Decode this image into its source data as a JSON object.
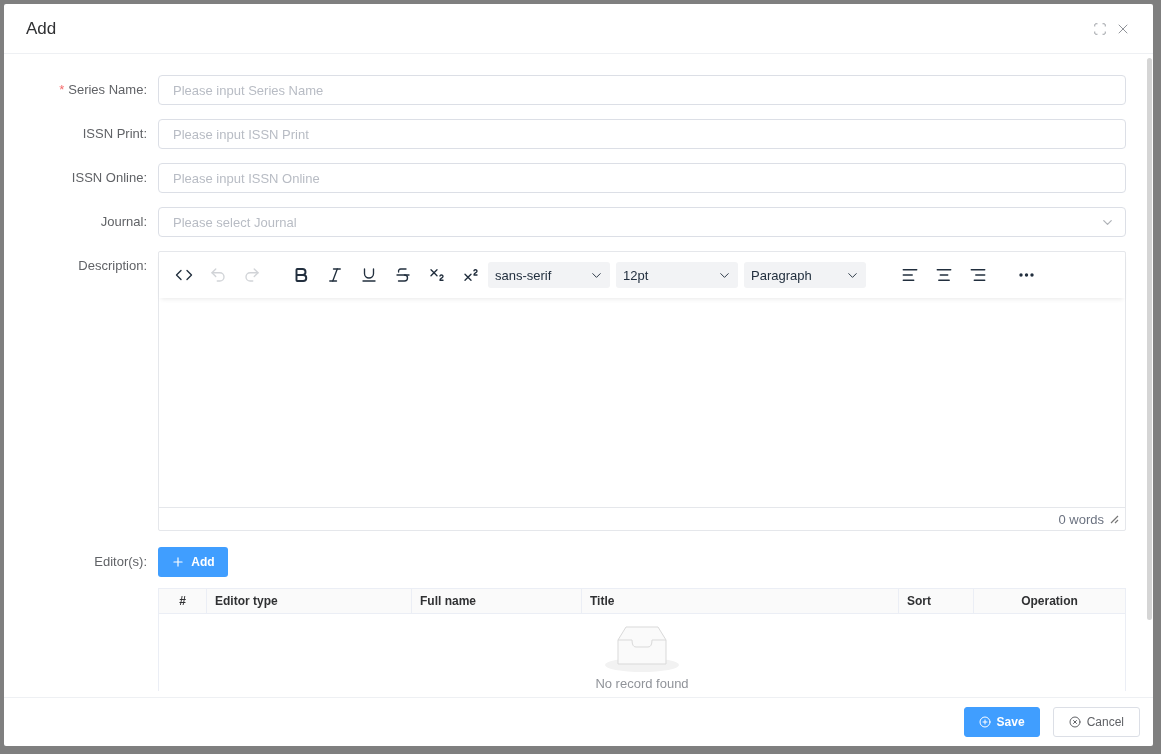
{
  "dialog": {
    "title": "Add"
  },
  "required_mark": "*",
  "fields": [
    {
      "label": "Series Name:",
      "required": true,
      "kind": "input",
      "placeholder": "Please input Series Name"
    },
    {
      "label": "ISSN Print:",
      "required": false,
      "kind": "input",
      "placeholder": "Please input ISSN Print"
    },
    {
      "label": "ISSN Online:",
      "required": false,
      "kind": "input",
      "placeholder": "Please input ISSN Online"
    },
    {
      "label": "Journal:",
      "required": false,
      "kind": "select",
      "placeholder": "Please select Journal"
    }
  ],
  "description": {
    "label": "Description:",
    "toolbar": [
      {
        "kind": "code",
        "disabled": false
      },
      {
        "kind": "undo",
        "disabled": true
      },
      {
        "kind": "redo",
        "disabled": true
      },
      {
        "kind": "gap"
      },
      {
        "kind": "bold",
        "disabled": false
      },
      {
        "kind": "italic",
        "disabled": false
      },
      {
        "kind": "underline",
        "disabled": false
      },
      {
        "kind": "strike",
        "disabled": false
      },
      {
        "kind": "sub",
        "disabled": false
      },
      {
        "kind": "sup",
        "disabled": false
      },
      {
        "kind": "dropdown",
        "value": "sans-serif"
      },
      {
        "kind": "dropdown",
        "value": "12pt"
      },
      {
        "kind": "dropdown",
        "value": "Paragraph"
      },
      {
        "kind": "gap"
      },
      {
        "kind": "align-left",
        "disabled": false
      },
      {
        "kind": "align-center",
        "disabled": false
      },
      {
        "kind": "align-right",
        "disabled": false
      },
      {
        "kind": "gap"
      },
      {
        "kind": "more",
        "disabled": false
      }
    ],
    "word_count": "0 words"
  },
  "editors": {
    "label": "Editor(s):",
    "add_button": "Add",
    "columns": [
      "#",
      "Editor type",
      "Full name",
      "Title",
      "Sort",
      "Operation"
    ],
    "empty_text": "No record found"
  },
  "footer": {
    "buttons": [
      {
        "label": "Save",
        "kind": "primary"
      },
      {
        "label": "Cancel",
        "kind": "default"
      }
    ]
  }
}
